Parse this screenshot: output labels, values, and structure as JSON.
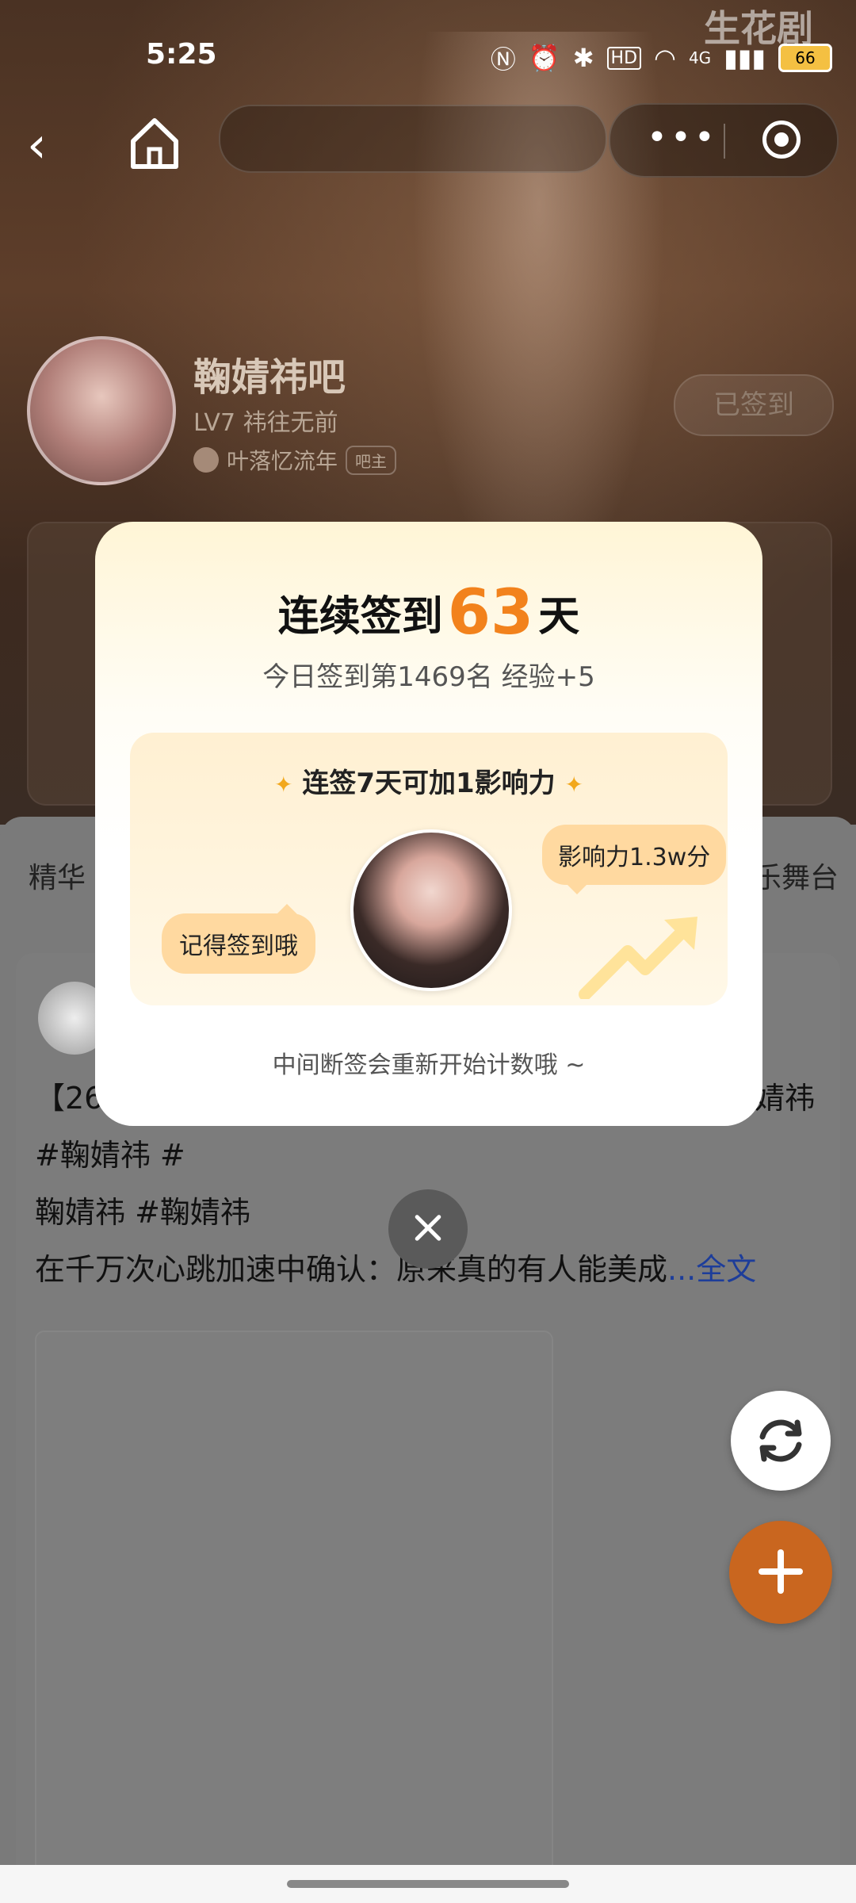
{
  "status_bar": {
    "time": "5:25",
    "battery": "66",
    "network": "4G"
  },
  "watermark": "生花剧",
  "nav": {
    "back_icon": "chevron-left-icon",
    "home_icon": "home-icon"
  },
  "forum": {
    "name": "鞠婧祎吧",
    "level": "LV7 祎往无前",
    "owner": "叶落忆流年",
    "owner_tag": "吧主",
    "signed_label": "已签到"
  },
  "tabs": {
    "left": "精华",
    "right": "乐舞台"
  },
  "post": {
    "line1_prefix": "【26",
    "line1_suffix": "婧祎",
    "line2": "#鞠婧祎 #",
    "line3": "鞠婧祎 #鞠婧祎",
    "line4": "在千万次心跳加速中确认：原来真的有人能美成",
    "full_text": "...全文"
  },
  "modal": {
    "title_prefix": "连续签到",
    "days": "63",
    "title_suffix": "天",
    "subtitle": "今日签到第1469名 经验+5",
    "reward_title": "连签7天可加1影响力",
    "bubble_left": "记得签到哦",
    "bubble_right": "影响力1.3w分",
    "footer": "中间断签会重新开始计数哦 ~"
  },
  "colors": {
    "accent": "#f2821c",
    "fab": "#c9661f",
    "link": "#1d3d9a"
  }
}
